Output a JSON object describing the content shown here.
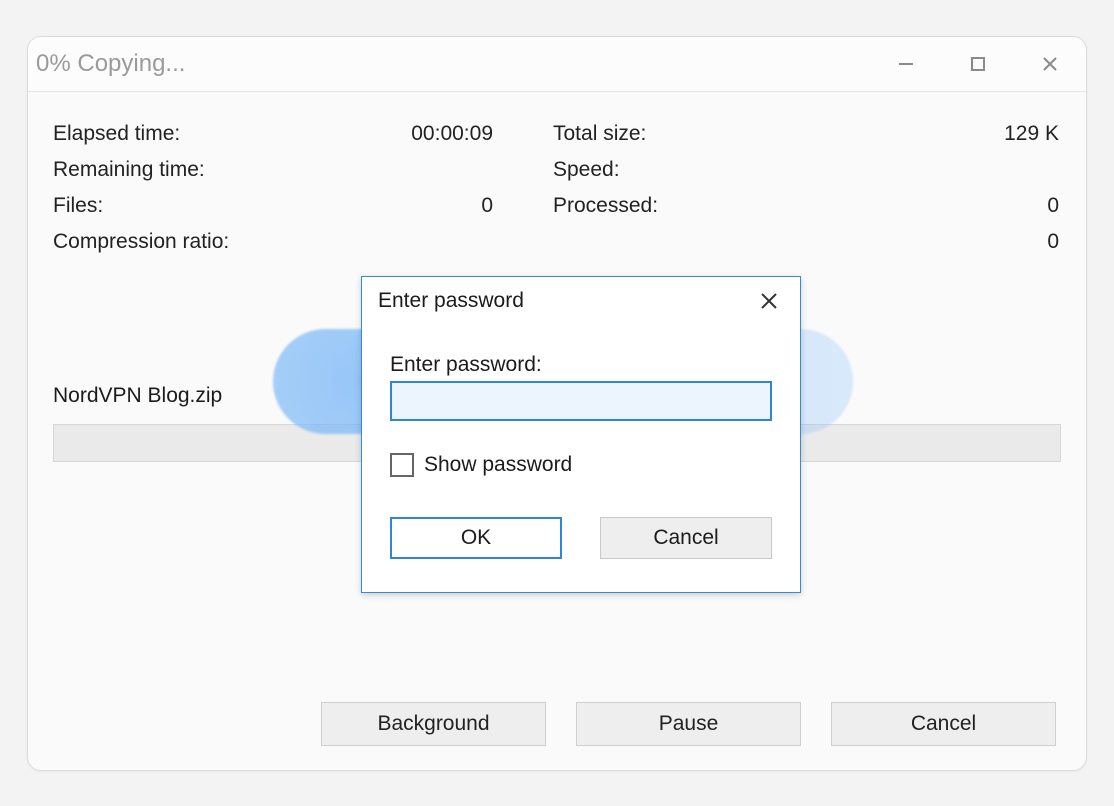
{
  "window": {
    "title": "0% Copying..."
  },
  "stats": {
    "elapsed_label": "Elapsed time:",
    "elapsed_value": "00:00:09",
    "total_size_label": "Total size:",
    "total_size_value": "129 K",
    "remaining_label": "Remaining time:",
    "remaining_value": "",
    "speed_label": "Speed:",
    "speed_value": "",
    "files_label": "Files:",
    "files_value": "0",
    "processed_label": "Processed:",
    "processed_value": "0",
    "ratio_label": "Compression ratio:",
    "ratio_value": "",
    "fourth_right_value": "0"
  },
  "file": {
    "name": "NordVPN Blog.zip"
  },
  "buttons": {
    "background": "Background",
    "pause": "Pause",
    "cancel": "Cancel"
  },
  "dialog": {
    "title": "Enter password",
    "field_label": "Enter password:",
    "password_value": "",
    "show_password": "Show password",
    "ok": "OK",
    "cancel": "Cancel"
  }
}
